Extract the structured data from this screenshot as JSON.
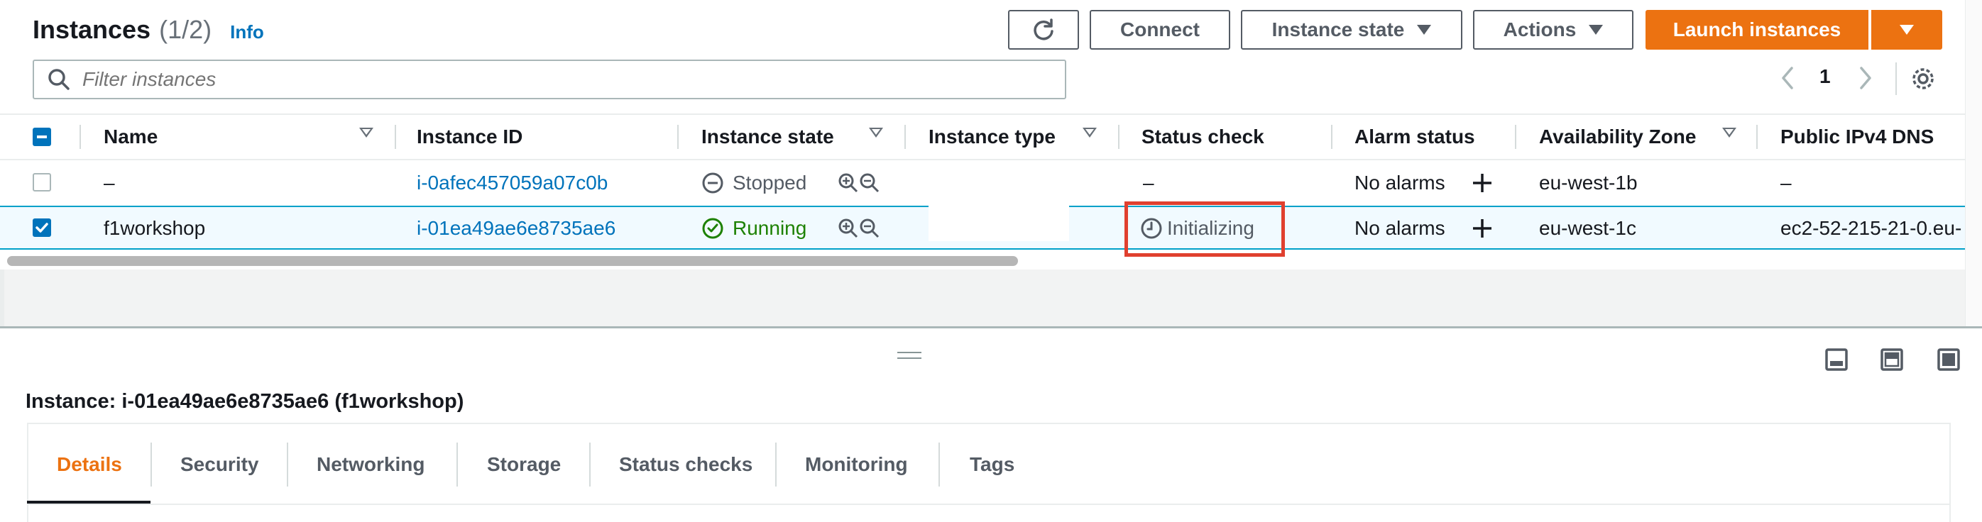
{
  "header": {
    "title": "Instances",
    "count": "(1/2)",
    "info": "Info",
    "connect_label": "Connect",
    "instance_state_label": "Instance state",
    "actions_label": "Actions",
    "launch_label": "Launch instances"
  },
  "search": {
    "placeholder": "Filter instances"
  },
  "pagination": {
    "page": "1"
  },
  "table": {
    "headers": {
      "name": "Name",
      "instance_id": "Instance ID",
      "instance_state": "Instance state",
      "instance_type": "Instance type",
      "status_check": "Status check",
      "alarm_status": "Alarm status",
      "availability_zone": "Availability Zone",
      "public_dns": "Public IPv4 DNS"
    },
    "rows": [
      {
        "selected": false,
        "name": "–",
        "instance_id": "i-0afec457059a07c0b",
        "state": "Stopped",
        "status_check": "–",
        "alarm_status": "No alarms",
        "zone": "eu-west-1b",
        "public_dns": "–"
      },
      {
        "selected": true,
        "name": "f1workshop",
        "instance_id": "i-01ea49ae6e8735ae6",
        "state": "Running",
        "status_check": "Initializing",
        "alarm_status": "No alarms",
        "zone": "eu-west-1c",
        "public_dns": "ec2-52-215-21-0.eu-"
      }
    ]
  },
  "details": {
    "title": "Instance: i-01ea49ae6e8735ae6 (f1workshop)",
    "tabs": [
      "Details",
      "Security",
      "Networking",
      "Storage",
      "Status checks",
      "Monitoring",
      "Tags"
    ],
    "active_tab": "Details"
  },
  "colors": {
    "accent_orange": "#ec7211",
    "link_blue": "#0073bb",
    "running_green": "#1d8102",
    "highlight_red": "#e0402f",
    "selected_row_bg": "#f1faff"
  }
}
